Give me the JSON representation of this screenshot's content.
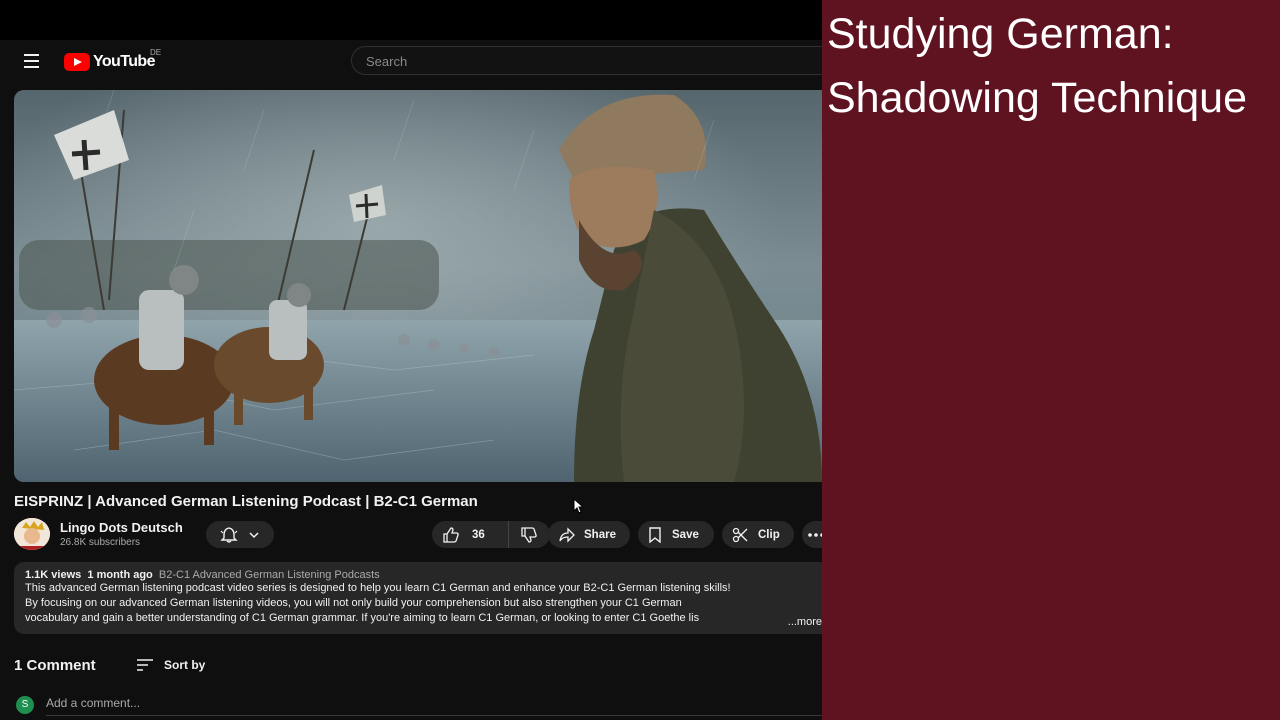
{
  "masthead": {
    "logo_text": "YouTube",
    "region": "DE",
    "search_placeholder": "Search"
  },
  "video": {
    "title": "EISPRINZ | Advanced German Listening Podcast | B2-C1 German"
  },
  "channel": {
    "name": "Lingo Dots Deutsch",
    "subscribers": "26.8K subscribers"
  },
  "actions": {
    "like_count": "36",
    "share_label": "Share",
    "save_label": "Save",
    "clip_label": "Clip"
  },
  "description": {
    "views": "1.1K views",
    "age": "1 month ago",
    "playlist_tag": "B2-C1 Advanced German Listening Podcasts",
    "line1": "This advanced German listening podcast video series is designed to help you learn C1 German and enhance your B2-C1 German listening skills!",
    "line2": "By focusing on our advanced German listening videos, you will not only build your comprehension but also strengthen your C1 German",
    "line3": "vocabulary and gain a better understanding of C1 German grammar. If you're aiming to learn C1 German, or looking to enter C1 Goethe lis",
    "more_label": "...more"
  },
  "comments": {
    "heading": "1 Comment",
    "sort_label": "Sort by",
    "user_initial": "S",
    "add_placeholder": "Add a comment..."
  },
  "side_panel": {
    "title_line1": "Studying German:",
    "title_line2": "Shadowing Technique",
    "background_color": "#5f1220"
  }
}
